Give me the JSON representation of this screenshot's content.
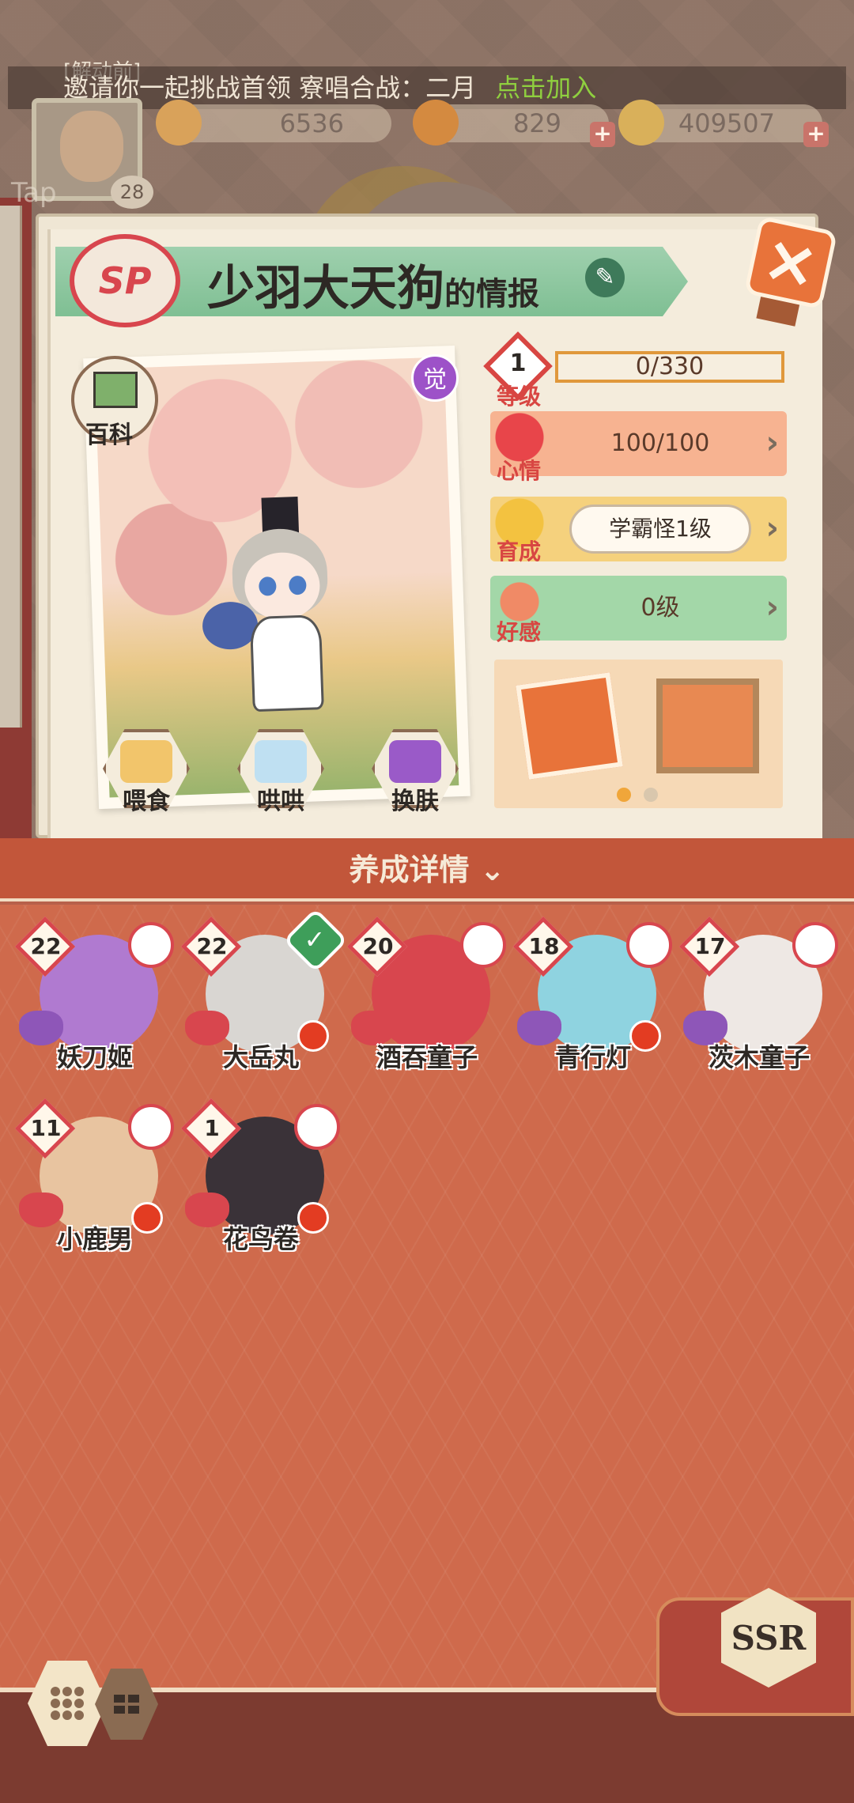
{
  "notice": {
    "line1": "[解动前]",
    "line2": "邀请你一起挑战首领 寮唱合战：二月",
    "link": "点击加入"
  },
  "currency": [
    {
      "name": "jade",
      "value": "6536"
    },
    {
      "name": "stamina",
      "value": "829"
    },
    {
      "name": "coins",
      "value": "409507"
    }
  ],
  "player": {
    "tap_label": "Tap",
    "level": "28"
  },
  "info_card": {
    "rarity": "SP",
    "title_name": "少羽大天狗",
    "title_suffix": "的情报",
    "baike_label": "百科",
    "awaken_label": "觉",
    "actions": [
      "喂食",
      "哄哄",
      "换肤"
    ],
    "stats": {
      "level": {
        "label": "等级",
        "num": "1",
        "value": "0/330"
      },
      "mood": {
        "label": "心情",
        "value": "100/100"
      },
      "grow": {
        "label": "育成",
        "value": "学霸怪1级"
      },
      "fav": {
        "label": "好感",
        "value": "0级"
      }
    }
  },
  "details": {
    "header": "养成详情",
    "shikigami": [
      {
        "level": "22",
        "name": "妖刀姬",
        "heart": "#8e56b8",
        "check": false,
        "dot": false,
        "color": "#b07ad0"
      },
      {
        "level": "22",
        "name": "大岳丸",
        "heart": "#d8464e",
        "check": true,
        "dot": true,
        "color": "#d9d6d2"
      },
      {
        "level": "20",
        "name": "酒吞童子",
        "heart": "#d8464e",
        "check": false,
        "dot": false,
        "color": "#d8464e"
      },
      {
        "level": "18",
        "name": "青行灯",
        "heart": "#8e56b8",
        "check": false,
        "dot": true,
        "color": "#8fd3e0"
      },
      {
        "level": "17",
        "name": "茨木童子",
        "heart": "#8e56b8",
        "check": false,
        "dot": false,
        "color": "#eee8e4"
      },
      {
        "level": "11",
        "name": "小鹿男",
        "heart": "#d8464e",
        "check": false,
        "dot": true,
        "color": "#e8c4a0"
      },
      {
        "level": "1",
        "name": "花鸟卷",
        "heart": "#d8464e",
        "check": false,
        "dot": true,
        "color": "#3a3238"
      }
    ]
  },
  "bottom": {
    "rarity_tab": "SSR"
  },
  "colors": {
    "accent_red": "#d8464e",
    "panel_orange": "#cf6a4c",
    "header": "#c2563a"
  }
}
